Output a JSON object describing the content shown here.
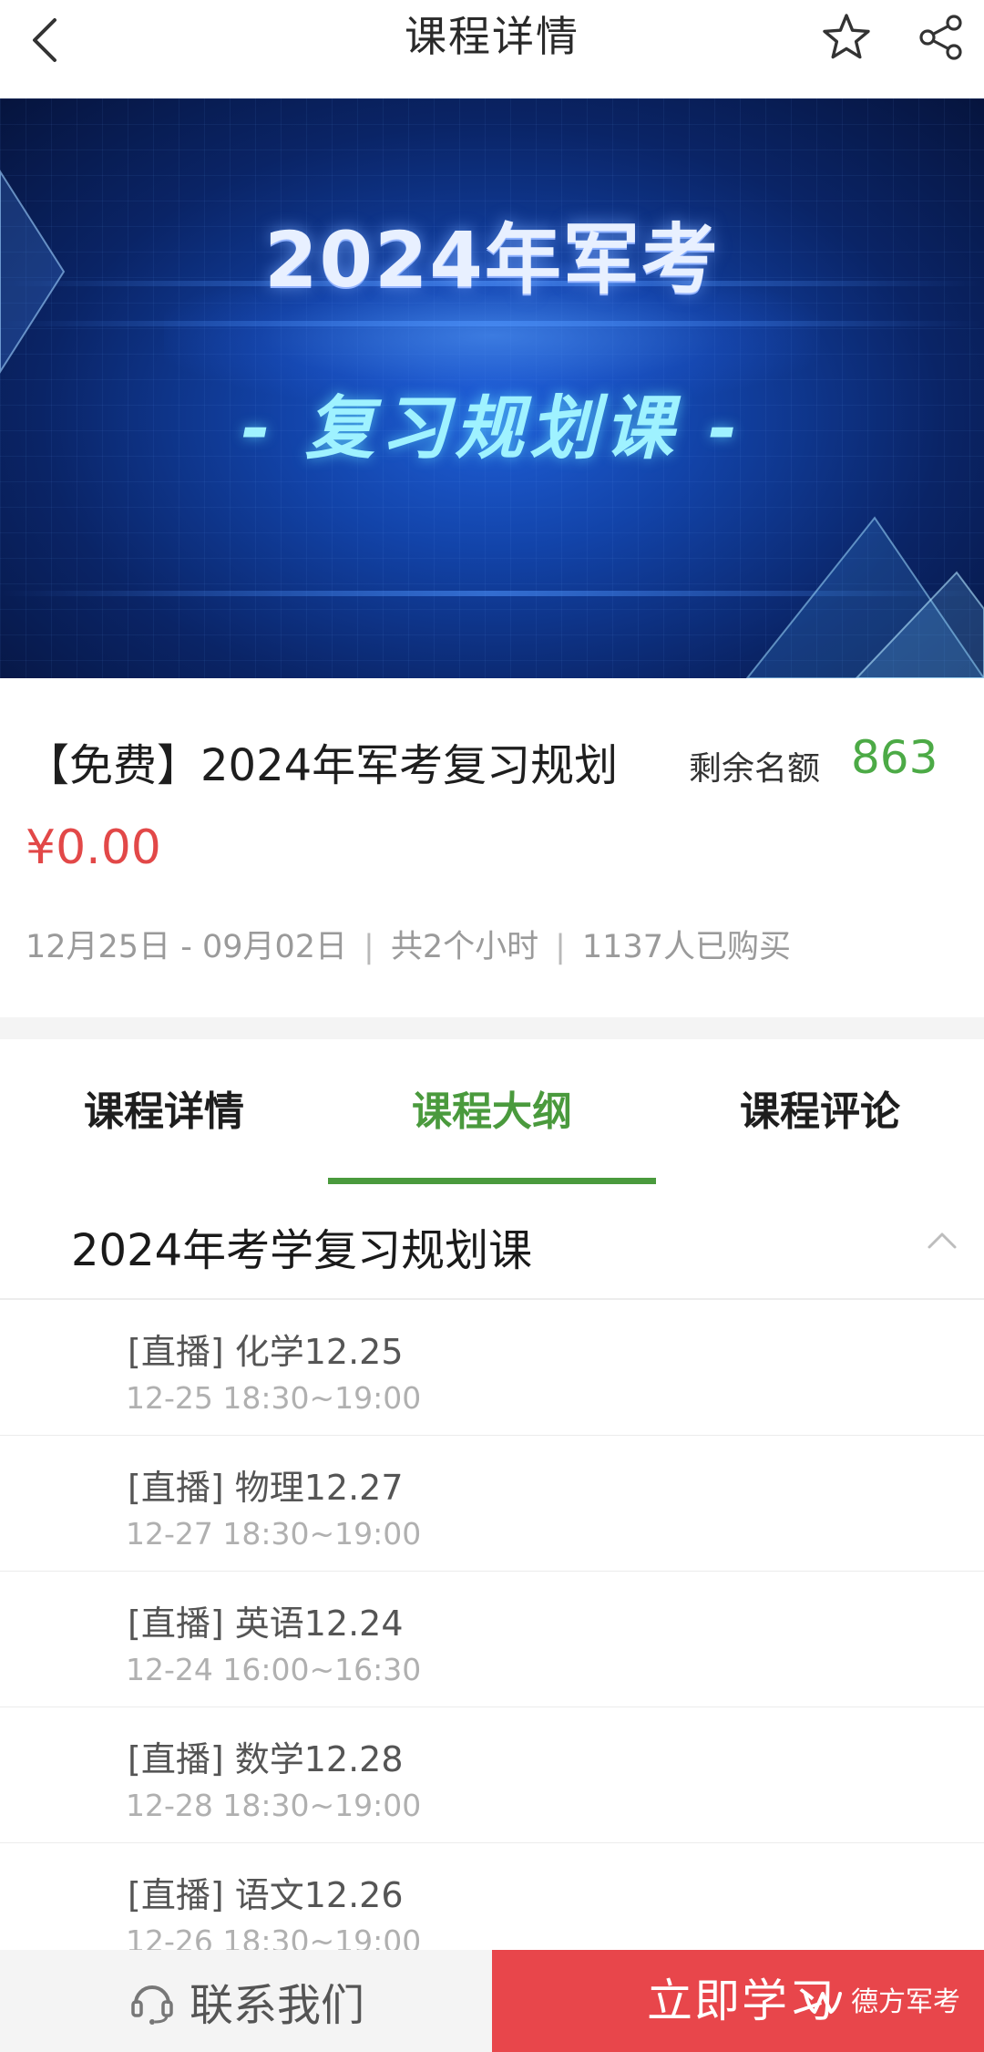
{
  "nav": {
    "title": "课程详情",
    "back_icon": "chevron-left-icon",
    "favorite_icon": "star-outline-icon",
    "share_icon": "share-icon"
  },
  "banner": {
    "title": "2024年军考",
    "subtitle": "- 复习规划课 -",
    "colors": {
      "dark": "#06143d",
      "mid": "#1243a8",
      "glow": "#1f5fd8",
      "subtitle": "#9ff2ff"
    }
  },
  "course": {
    "name": "【免费】2024年军考复习规划",
    "quota_label": "剩余名额",
    "quota_value": "863",
    "price": "¥0.00",
    "date_range": "12月25日 - 09月02日",
    "duration": "共2个小时",
    "purchased": "1137人已购买",
    "separator": "|"
  },
  "tabs": [
    {
      "label": "课程详情",
      "active": false
    },
    {
      "label": "课程大纲",
      "active": true
    },
    {
      "label": "课程评论",
      "active": false
    }
  ],
  "outline": {
    "section_title": "2024年考学复习规划课",
    "expanded": true,
    "lessons": [
      {
        "title": "[直播] 化学12.25",
        "time": "12-25 18:30~19:00"
      },
      {
        "title": "[直播] 物理12.27",
        "time": "12-27 18:30~19:00"
      },
      {
        "title": "[直播] 英语12.24",
        "time": "12-24 16:00~16:30"
      },
      {
        "title": "[直播] 数学12.28",
        "time": "12-28 18:30~19:00"
      },
      {
        "title": "[直播] 语文12.26",
        "time": "12-26 18:30~19:00"
      }
    ]
  },
  "bottom": {
    "contact_label": "联系我们",
    "contact_icon": "headset-icon",
    "study_label": "立即学习",
    "watermark_text": "德方军考",
    "watermark_icon": "wechat-channel-icon"
  },
  "colors": {
    "accent_green": "#4a9a3d",
    "quota_green": "#4caa46",
    "price_red": "#e24848",
    "study_red": "#e8464b"
  }
}
